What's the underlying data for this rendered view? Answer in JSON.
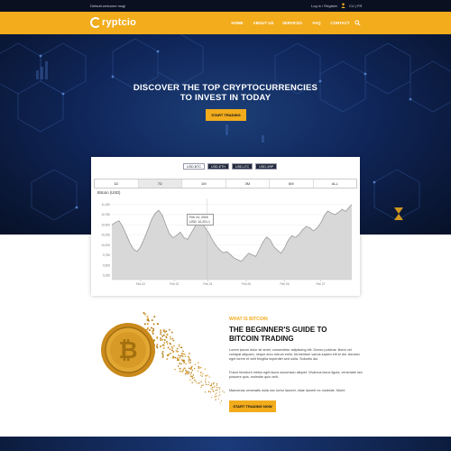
{
  "topbar": {
    "welcome": "Default welcome msg!",
    "login": "Log in / Register",
    "lang": "CU | FR"
  },
  "brand": {
    "logo_text": "ryptcio"
  },
  "nav": {
    "items": [
      {
        "label": "HOME",
        "active": true
      },
      {
        "label": "ABOUT US",
        "active": false
      },
      {
        "label": "SERVICES",
        "active": false
      },
      {
        "label": "FAQ",
        "active": false
      },
      {
        "label": "CONTACT",
        "active": false
      }
    ]
  },
  "hero": {
    "title_line1": "DISCOVER THE TOP CRYPTOCURRENCIES",
    "title_line2": "TO INVEST IN TODAY",
    "button": "START TRADING"
  },
  "chart_widget": {
    "pairs": [
      {
        "label": "USD-BTC",
        "active": true
      },
      {
        "label": "USD-ETH",
        "active": false
      },
      {
        "label": "USD-LTC",
        "active": false
      },
      {
        "label": "USD-XRP",
        "active": false
      }
    ],
    "ranges": [
      {
        "label": "1D",
        "active": false
      },
      {
        "label": "7D",
        "active": true
      },
      {
        "label": "1M",
        "active": false
      },
      {
        "label": "3M",
        "active": false
      },
      {
        "label": "6M",
        "active": false
      },
      {
        "label": "ALL",
        "active": false
      }
    ],
    "tooltip": {
      "date": "Feb 24, 2018",
      "value": "USD: 10,201.1"
    }
  },
  "chart_data": {
    "type": "area",
    "title": "Bitcoin (USD)",
    "xlabel": "",
    "ylabel": "",
    "y_ticks": [
      11000,
      10750,
      10500,
      10250,
      10000,
      9750,
      9500,
      9250
    ],
    "x_ticks": [
      "Feb 22",
      "Feb 23",
      "Feb 24",
      "Feb 25",
      "Feb 26",
      "Feb 27"
    ],
    "ylim": [
      9150,
      11150
    ],
    "x_range": [
      0,
      100
    ],
    "x_tick_positions": [
      12,
      26,
      40,
      56,
      72,
      87
    ],
    "series": [
      {
        "x": [
          0,
          1.5,
          3,
          4.5,
          6,
          7.5,
          9,
          10.5,
          12,
          13.5,
          15,
          16.5,
          18,
          19.5,
          21,
          22.5,
          24,
          25.5,
          27,
          28.5,
          30,
          31.5,
          33,
          34.5,
          36,
          37.5,
          39,
          40.5,
          42,
          43.5,
          45,
          46.5,
          48,
          49.5,
          51,
          52.5,
          54,
          55.5,
          57,
          58.5,
          60,
          61.5,
          63,
          64.5,
          66,
          67.5,
          69,
          70.5,
          72,
          73.5,
          75,
          76.5,
          78,
          79.5,
          81,
          82.5,
          84,
          85.5,
          87,
          88.5,
          90,
          91.5,
          93,
          94.5,
          96,
          97.5,
          99,
          100
        ],
        "values": [
          10500,
          10560,
          10600,
          10460,
          10260,
          10060,
          9900,
          9840,
          9960,
          10160,
          10380,
          10620,
          10780,
          10860,
          10740,
          10500,
          10280,
          10180,
          10240,
          10320,
          10190,
          10140,
          10290,
          10440,
          10630,
          10560,
          10420,
          10290,
          10120,
          9980,
          9880,
          9810,
          9840,
          9760,
          9680,
          9640,
          9600,
          9700,
          9800,
          9760,
          9720,
          9900,
          10080,
          10200,
          10130,
          9960,
          9880,
          9800,
          9930,
          10120,
          10230,
          10190,
          10260,
          10380,
          10460,
          10430,
          10350,
          10420,
          10540,
          10720,
          10840,
          10790,
          10750,
          10810,
          10880,
          10830,
          10940,
          11000
        ]
      }
    ],
    "grid": true,
    "line_color": "#9a9a9a",
    "fill_color": "#d8d8d8"
  },
  "about": {
    "eyebrow": "WHAT IS BITCOIN",
    "title_line1": "THE BEGINNER'S GUIDE TO",
    "title_line2": "BITCOIN TRADING",
    "para1": "Lorem ipsum dolor sit amet, consectetur adipiscing elit. Donec pulvinar. libero vel volutpat aliquam, neque arcu rutrum enim, fermentum varius sapien elit id dui. Aenean eget lorem et velit fringilla imperdiet sed nulla. Sobortis dui.",
    "para2": "Fusce tincidunt metus eget lacus accumsan aliquet. Vivamus lacus ligula, venenatis nec posuere quis, molestie quis velit.",
    "para3": "Maecenas venenatis nulla nec tortor laoreet, vitae laoreet ex molestie. Morbi",
    "button": "START TRADING NOW"
  },
  "colors": {
    "accent": "#f2ac1c",
    "hero_dark": "#0a1838",
    "topbar": "#0b1020"
  }
}
